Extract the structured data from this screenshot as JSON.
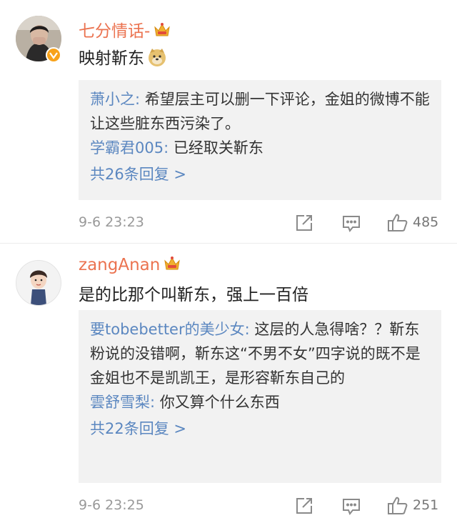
{
  "comments": [
    {
      "username": "七分情话-",
      "content": "映射靳东",
      "replies": [
        {
          "name": "萧小之",
          "text": "希望层主可以删一下评论，金姐的微博不能让这些脏东西污染了。"
        },
        {
          "name": "学霸君005",
          "text": "已经取关靳东"
        }
      ],
      "more": "共26条回复 >",
      "time": "9-6 23:23",
      "likes": "485"
    },
    {
      "username": "zangAnan",
      "content": "是的比那个叫靳东，强上一百倍",
      "replies": [
        {
          "name": "要tobebetter的美少女",
          "text": "这层的人急得啥？？靳东粉说的没错啊，靳东这“不男不女”四字说的既不是金姐也不是凯凯王，是形容靳东自己的"
        },
        {
          "name": "雲舒雪梨",
          "text": "你又算个什么东西"
        }
      ],
      "more": "共22条回复 >",
      "time": "9-6 23:25",
      "likes": "251"
    }
  ],
  "colors": {
    "username": "#eb7350",
    "reply_name": "#5b87c0",
    "reply_bg": "#f2f2f2",
    "meta": "#999999"
  },
  "icons": [
    "crown-badge-icon",
    "verified-badge-icon",
    "doge-emoji-icon",
    "forward-icon",
    "comment-icon",
    "like-icon"
  ]
}
